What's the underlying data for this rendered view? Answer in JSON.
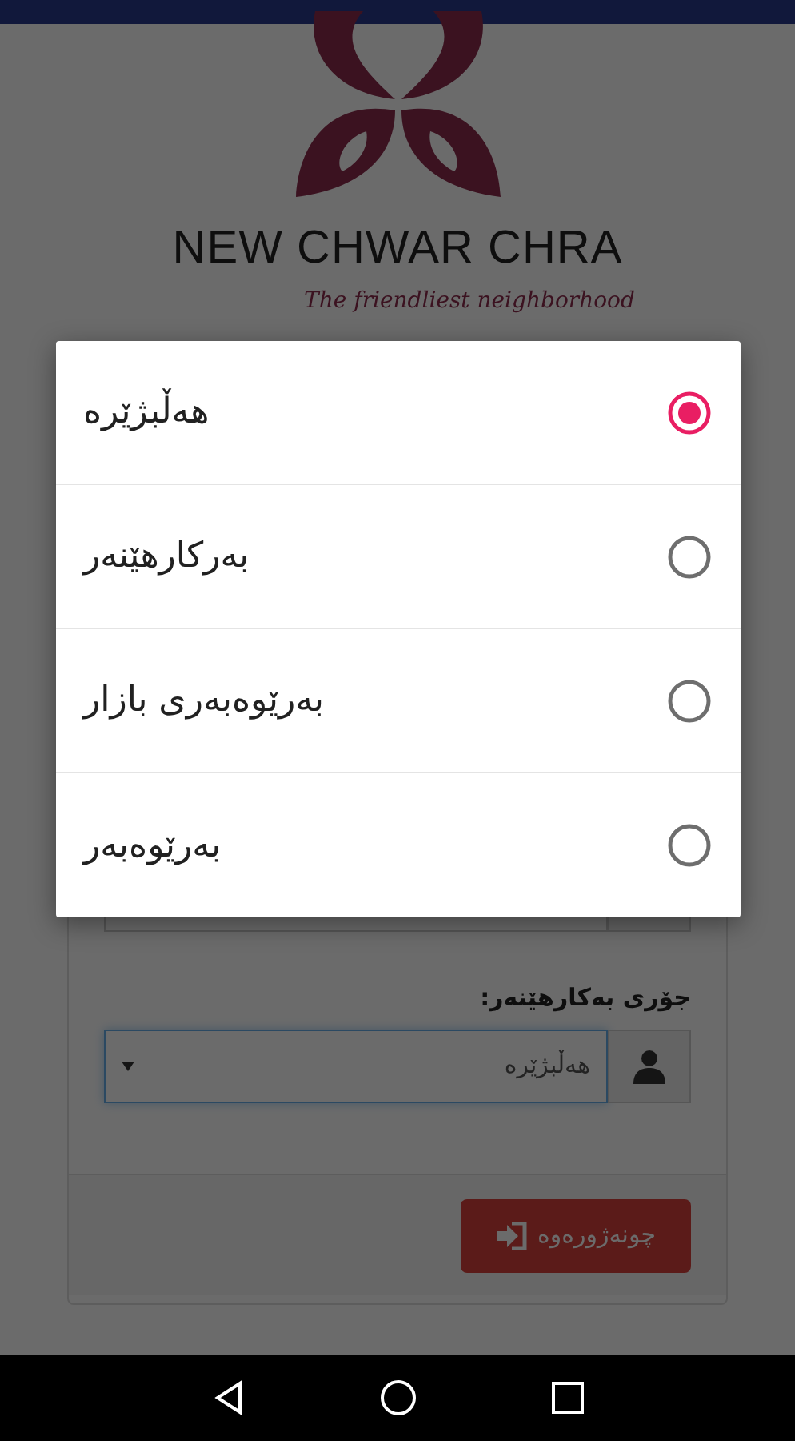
{
  "logo": {
    "title": "NEW CHWAR CHRA",
    "tagline": "The friendliest neighborhood"
  },
  "form": {
    "user_type_label": "جۆری بەکارهێنەر:",
    "user_type_value": "هەڵبژێرە",
    "login_button": "چونەژورەوە"
  },
  "dialog": {
    "options": [
      {
        "label": "هەڵبژێرە",
        "selected": true
      },
      {
        "label": "بەرکارهێنەر",
        "selected": false
      },
      {
        "label": "بەرێوەبەری بازار",
        "selected": false
      },
      {
        "label": "بەرێوەبەر",
        "selected": false
      }
    ]
  }
}
